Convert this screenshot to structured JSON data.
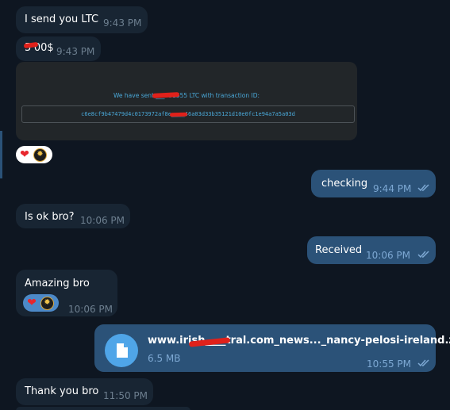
{
  "messages": [
    {
      "id": "m1",
      "text": "I send you LTC",
      "time": "9:43 PM"
    },
    {
      "id": "m2",
      "text": "5'00$",
      "time": "9:43 PM"
    },
    {
      "id": "m3",
      "receipt_line": "We have sent ___751555 LTC  with transaction ID:",
      "receipt_txid": "c6e8cf9b47479d4c0173972af8e____46a03d33b35121d10e0fc1e94a7a5a03d"
    },
    {
      "id": "m4",
      "text": "checking",
      "time": "9:44 PM"
    },
    {
      "id": "m5",
      "text": "Is ok bro?",
      "time": "10:06 PM"
    },
    {
      "id": "m6",
      "text": "Received",
      "time": "10:06 PM"
    },
    {
      "id": "m7",
      "text": "Amazing bro",
      "time": "10:06 PM"
    },
    {
      "id": "m8",
      "file_name": "www.irish____tral.com_news..._nancy-pelosi-ireland.zip",
      "file_size": "6.5 MB",
      "time": "10:55 PM"
    },
    {
      "id": "m9",
      "text": "Thank you bro",
      "time": "11:50 PM"
    }
  ],
  "reaction_icons": [
    "heart-reaction",
    "avatar-reaction"
  ],
  "icons": {
    "heart": "❤",
    "avatar": "✹",
    "file": "file-icon",
    "check": "double-check-icon"
  },
  "colors": {
    "background": "#0e1621",
    "incoming": "#182533",
    "outgoing": "#2b5278",
    "file_icon": "#4fa5e8",
    "redaction": "#e0211b",
    "receipt_text": "#4aa8d8"
  }
}
